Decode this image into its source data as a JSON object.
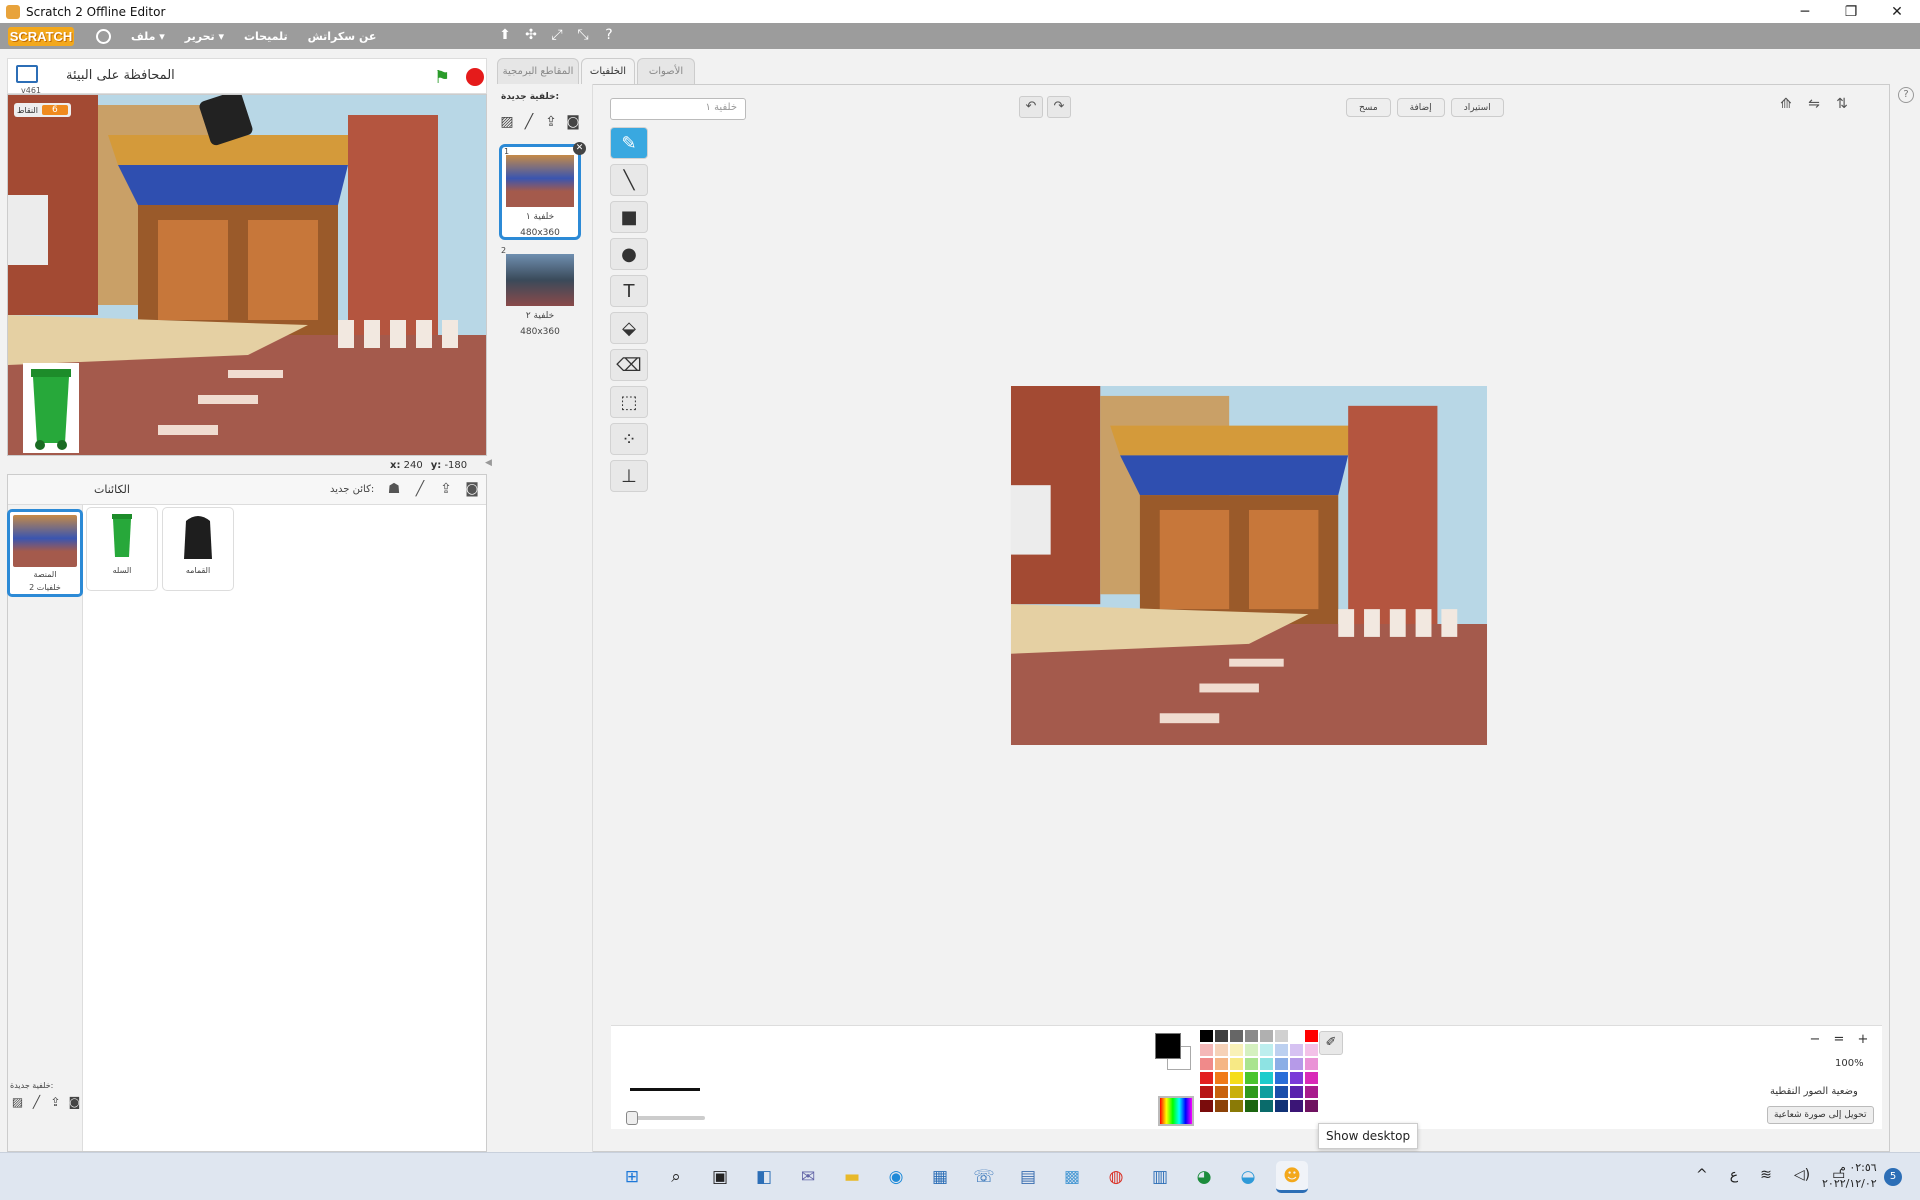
{
  "window": {
    "title": "Scratch 2 Offline Editor",
    "minimize_glyph": "─",
    "maximize_glyph": "❐",
    "close_glyph": "✕"
  },
  "menubar": {
    "logo": "SCRATCH",
    "file": "ملف ▾",
    "edit": "تحرير ▾",
    "tips": "تلميحات",
    "about": "عن سكراتش",
    "right_tools": [
      "⬆",
      "✣",
      "⤢",
      "⤡",
      "?"
    ]
  },
  "stage": {
    "title": "المحافظة على البيئة",
    "version": "v461",
    "flag_glyph": "⚑",
    "score_label": "النقاط",
    "score_value": "6",
    "coords_x_label": "x:",
    "coords_x": "240",
    "coords_y_label": "y:",
    "coords_y": "-180"
  },
  "sprites_pane": {
    "title": "الكائنات",
    "new_sprite_label": "كائن جديد:",
    "icons": [
      "☗",
      "╱",
      "⇪",
      "◙"
    ],
    "stage_card": {
      "label": "المنصة",
      "sublabel": "خلفيات 2"
    },
    "sprites": [
      {
        "name": "السله"
      },
      {
        "name": "القمامه"
      }
    ],
    "new_backdrop_label": "خلفية جديدة:",
    "new_backdrop_icons": [
      "▨",
      "╱",
      "⇪",
      "◙"
    ]
  },
  "tabs": {
    "scripts": "المقاطع البرمجية",
    "backdrops": "الخلفيات",
    "sounds": "الأصوات"
  },
  "backdrops": {
    "new_label": "خلفية جديدة:",
    "new_icons": [
      "▨",
      "╱",
      "⇪",
      "◙"
    ],
    "items": [
      {
        "num": "1",
        "name": "خلفية ١",
        "size": "480x360"
      },
      {
        "num": "2",
        "name": "خلفية ٢",
        "size": "480x360"
      }
    ]
  },
  "paint_editor": {
    "costume_name": "خلفية ١",
    "undo_glyph": "↶",
    "redo_glyph": "↷",
    "clear": "مسح",
    "add": "إضافة",
    "import": "استيراد",
    "right_tools": [
      "⟰",
      "⇋",
      "⇅"
    ],
    "tools": [
      "✎",
      "╲",
      "■",
      "●",
      "T",
      "⬙",
      "⌫",
      "⬚",
      "⁘",
      "⊥"
    ],
    "zoom_out": "−",
    "zoom_reset": "=",
    "zoom_in": "+",
    "zoom_value": "100%",
    "mode_label": "وضعية الصور النقطية",
    "convert_button": "تحويل إلى صورة شعاعية",
    "eyedropper_glyph": "✐",
    "palette_colors": [
      "#000000",
      "#404040",
      "#666666",
      "#8a8a8a",
      "#b0b0b0",
      "#d0d0d0",
      "#ffffff",
      "#ff0000",
      "#f4b8b8",
      "#f6d2b8",
      "#f9f1b8",
      "#d5f1c0",
      "#bdeeee",
      "#bcd0f0",
      "#d6c2f2",
      "#f3c1e8",
      "#f08a8a",
      "#f5b585",
      "#f7e985",
      "#a9e48f",
      "#8ee3e3",
      "#8aaee6",
      "#b69ae8",
      "#ea93d6",
      "#e32020",
      "#f07a18",
      "#f5dd1a",
      "#4ac52e",
      "#1dcccc",
      "#2a6ed8",
      "#7a3ad8",
      "#d82ab8",
      "#b81616",
      "#c8620e",
      "#c9b00c",
      "#2f9a1d",
      "#0f9f9f",
      "#1b4fab",
      "#5a23ad",
      "#a81c8e",
      "#7a0c0c",
      "#8c4308",
      "#8a7a06",
      "#1c6610",
      "#0a6b6b",
      "#113276",
      "#3b1576",
      "#6f1260"
    ]
  },
  "tooltip": "Show desktop",
  "taskbar": {
    "icons": [
      {
        "name": "start-icon",
        "glyph": "⊞",
        "color": "#1e78d8"
      },
      {
        "name": "search-icon",
        "glyph": "⌕",
        "color": "#222222"
      },
      {
        "name": "task-view-icon",
        "glyph": "▣",
        "color": "#222222"
      },
      {
        "name": "widgets-icon",
        "glyph": "◧",
        "color": "#2c6eb6"
      },
      {
        "name": "chat-icon",
        "glyph": "✉",
        "color": "#6264a7"
      },
      {
        "name": "file-explorer-icon",
        "glyph": "▬",
        "color": "#e8b92a"
      },
      {
        "name": "edge-icon",
        "glyph": "◉",
        "color": "#1e8ad8"
      },
      {
        "name": "store-icon",
        "glyph": "▦",
        "color": "#2c6eb6"
      },
      {
        "name": "phone-icon",
        "glyph": "☏",
        "color": "#2c6eb6"
      },
      {
        "name": "app-icon-1",
        "glyph": "▤",
        "color": "#3b6fb0"
      },
      {
        "name": "app-icon-2",
        "glyph": "▩",
        "color": "#4a9ad4"
      },
      {
        "name": "chrome-icon",
        "glyph": "◍",
        "color": "#d93025"
      },
      {
        "name": "notepad-icon",
        "glyph": "▥",
        "color": "#2c6eb6"
      },
      {
        "name": "app-icon-3",
        "glyph": "◕",
        "color": "#1c8c3c"
      },
      {
        "name": "app-icon-4",
        "glyph": "◒",
        "color": "#2f9ad8"
      },
      {
        "name": "scratch-icon",
        "glyph": "☻",
        "color": "#f3a81c"
      }
    ],
    "tray_up": "^",
    "tray_lang": "ع",
    "tray_wifi": "≋",
    "tray_volume": "◁)",
    "tray_battery": "▭",
    "time": "٠٢:٥٦ م",
    "date": "٢٠٢٢/١٢/٠٢",
    "notifications": "5"
  }
}
